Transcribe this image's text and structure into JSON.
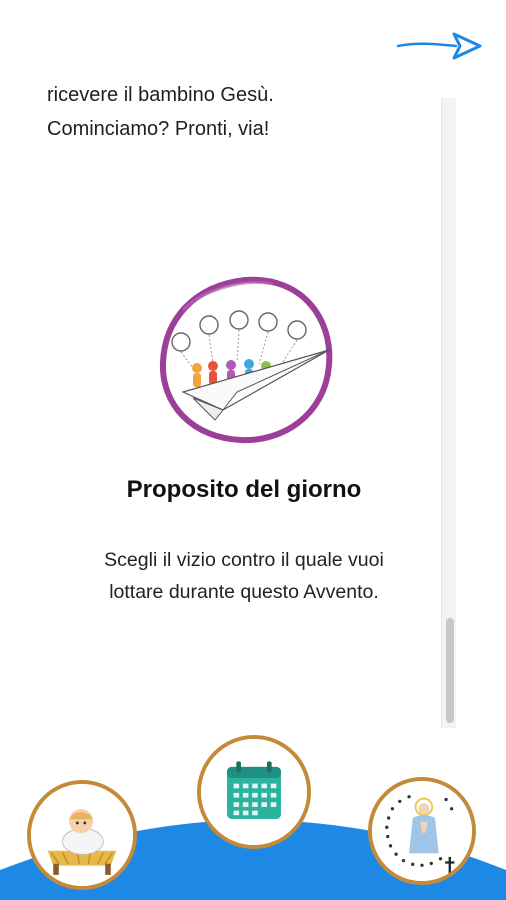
{
  "intro": {
    "line_cut": "ricevere il bambino Gesù.",
    "line_full": "Cominciamo? Pronti, via!"
  },
  "section": {
    "title": "Proposito del giorno",
    "body_line1": "Scegli il vizio contro il quale vuoi",
    "body_line2": "lottare durante questo Avvento."
  },
  "nav": {
    "items": [
      {
        "icon": "nativity-icon"
      },
      {
        "icon": "calendar-icon"
      },
      {
        "icon": "rosary-icon"
      }
    ]
  },
  "colors": {
    "accent_blue": "#1e88e5",
    "ring_purple": "#9c3f98",
    "button_border": "#c48a3a",
    "calendar_teal": "#2bb3a0"
  }
}
